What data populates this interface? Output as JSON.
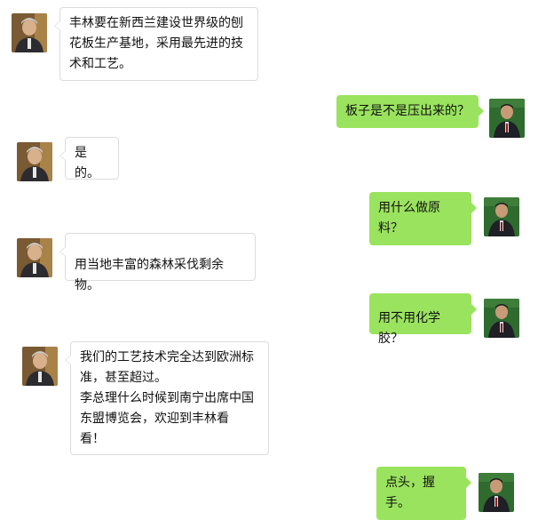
{
  "conversation": {
    "messages": [
      {
        "side": "left",
        "avatar": "gray-haired-man-avatar",
        "text": "丰林要在新西兰建设世界级的刨\n花板生产基地，采用最先进的技\n术和工艺。"
      },
      {
        "side": "right",
        "avatar": "man-in-suit-avatar",
        "text": "板子是不是压出来的？"
      },
      {
        "side": "left",
        "avatar": "gray-haired-man-avatar",
        "text": "是的。"
      },
      {
        "side": "right",
        "avatar": "man-in-suit-avatar",
        "text": "用什么做原料？"
      },
      {
        "side": "left",
        "avatar": "gray-haired-man-avatar",
        "text": "用当地丰富的森林采伐剩余物。"
      },
      {
        "side": "right",
        "avatar": "man-in-suit-avatar",
        "text": "用不用化学胶？"
      },
      {
        "side": "left",
        "avatar": "gray-haired-man-avatar",
        "text": "我们的工艺技术完全达到欧洲标\n准，甚至超过。\n李总理什么时候到南宁出席中国\n东盟博览会，欢迎到丰林看\n看！"
      },
      {
        "side": "right",
        "avatar": "man-in-suit-avatar",
        "text": "点头，握手。"
      }
    ]
  },
  "colors": {
    "right_bubble": "#9ae35e",
    "left_bubble": "#ffffff",
    "left_border": "#dcdcdc"
  }
}
